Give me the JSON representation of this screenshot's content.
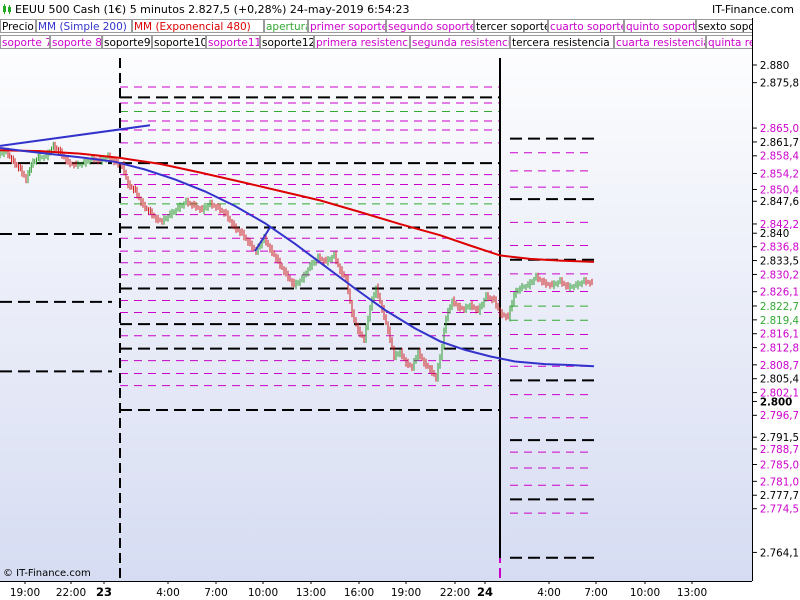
{
  "header": {
    "title": "EEUU 500 Cash (1€)   5 minutos   2.827,5 (+0,28%)   24-may-2019 6:54:23",
    "brand": "IT-Finance.com"
  },
  "legend_row1": [
    {
      "label": "Precio",
      "color": "#000000"
    },
    {
      "label": "MM (Simple 200)",
      "color": "#3333cc"
    },
    {
      "label": "MM (Exponencial 480)",
      "color": "#dd0000"
    },
    {
      "label": "apertura",
      "color": "#33aa33"
    },
    {
      "label": "primer soporte",
      "color": "#cc00cc"
    },
    {
      "label": "segundo soporte",
      "color": "#cc00cc"
    },
    {
      "label": "tercer soporte",
      "color": "#000000"
    },
    {
      "label": "cuarto soporte",
      "color": "#cc00cc"
    },
    {
      "label": "quinto soporte",
      "color": "#cc00cc"
    },
    {
      "label": "sexto soporte",
      "color": "#000000"
    }
  ],
  "legend_row2": [
    {
      "label": "soporte 7",
      "color": "#cc00cc"
    },
    {
      "label": "soporte 8",
      "color": "#cc00cc"
    },
    {
      "label": "soporte9",
      "color": "#000000"
    },
    {
      "label": "soporte10",
      "color": "#000000"
    },
    {
      "label": "soporte11",
      "color": "#cc00cc"
    },
    {
      "label": "soporte12",
      "color": "#000000"
    },
    {
      "label": "primera resistencia",
      "color": "#cc00cc"
    },
    {
      "label": "segunda resistencia",
      "color": "#cc00cc"
    },
    {
      "label": "tercera resistencia",
      "color": "#000000"
    },
    {
      "label": "cuarta resistencia",
      "color": "#cc00cc"
    },
    {
      "label": "quinta resi",
      "color": "#cc00cc"
    }
  ],
  "copyright": "© IT-Finance.com",
  "chart_data": {
    "type": "line",
    "ylim": [
      2.7625,
      2.882
    ],
    "y_ticks": [
      {
        "label": "2.880",
        "value": 2.88,
        "color": "#000000"
      },
      {
        "label": "2.875,8",
        "value": 2.8758,
        "color": "#000000"
      },
      {
        "label": "2.865,0",
        "value": 2.865,
        "color": "#cc00cc"
      },
      {
        "label": "2.861,7",
        "value": 2.8617,
        "color": "#000000"
      },
      {
        "label": "2.858,4",
        "value": 2.8584,
        "color": "#cc00cc"
      },
      {
        "label": "2.854,2",
        "value": 2.8542,
        "color": "#cc00cc"
      },
      {
        "label": "2.850,4",
        "value": 2.8504,
        "color": "#cc00cc"
      },
      {
        "label": "2.847,6",
        "value": 2.8476,
        "color": "#000000"
      },
      {
        "label": "2.842,2",
        "value": 2.8422,
        "color": "#cc00cc"
      },
      {
        "label": "2.840",
        "value": 2.84,
        "color": "#000000"
      },
      {
        "label": "2.836,8",
        "value": 2.8368,
        "color": "#cc00cc"
      },
      {
        "label": "2.833,5",
        "value": 2.8335,
        "color": "#000000"
      },
      {
        "label": "2.830,2",
        "value": 2.8302,
        "color": "#cc00cc"
      },
      {
        "label": "2.826,1",
        "value": 2.8261,
        "color": "#cc00cc"
      },
      {
        "label": "2.822,7",
        "value": 2.8227,
        "color": "#33aa33"
      },
      {
        "label": "2.819,4",
        "value": 2.8194,
        "color": "#33aa33"
      },
      {
        "label": "2.816,1",
        "value": 2.8161,
        "color": "#cc00cc"
      },
      {
        "label": "2.812,8",
        "value": 2.8128,
        "color": "#cc00cc"
      },
      {
        "label": "2.808,7",
        "value": 2.8087,
        "color": "#cc00cc"
      },
      {
        "label": "2.805,4",
        "value": 2.8054,
        "color": "#000000"
      },
      {
        "label": "2.802,1",
        "value": 2.8021,
        "color": "#cc00cc"
      },
      {
        "label": "2.800",
        "value": 2.8,
        "color": "#000000"
      },
      {
        "label": "2.796,7",
        "value": 2.7967,
        "color": "#cc00cc"
      },
      {
        "label": "2.791,5",
        "value": 2.7915,
        "color": "#000000"
      },
      {
        "label": "2.788,7",
        "value": 2.7887,
        "color": "#cc00cc"
      },
      {
        "label": "2.785,0",
        "value": 2.785,
        "color": "#cc00cc"
      },
      {
        "label": "2.781,0",
        "value": 2.781,
        "color": "#cc00cc"
      },
      {
        "label": "2.777,7",
        "value": 2.7777,
        "color": "#000000"
      },
      {
        "label": "2.774,5",
        "value": 2.7745,
        "color": "#cc00cc"
      },
      {
        "label": "2.764,1",
        "value": 2.7641,
        "color": "#000000"
      }
    ],
    "x_ticks": [
      "19:00",
      "22:00",
      "23",
      "4:00",
      "7:00",
      "10:00",
      "13:00",
      "16:00",
      "19:00",
      "22:00",
      "24",
      "4:00",
      "7:00",
      "10:00",
      "13:00"
    ],
    "day_bold_ticks": [
      "23",
      "24"
    ],
    "sma200": [
      [
        0,
        2.8595
      ],
      [
        25,
        2.8588
      ],
      [
        55,
        2.858
      ],
      [
        85,
        2.8572
      ],
      [
        115,
        2.8563
      ],
      [
        145,
        2.8545
      ],
      [
        175,
        2.8522
      ],
      [
        205,
        2.8494
      ],
      [
        235,
        2.846
      ],
      [
        265,
        2.842
      ],
      [
        295,
        2.8372
      ],
      [
        325,
        2.832
      ],
      [
        355,
        2.8268
      ],
      [
        385,
        2.8218
      ],
      [
        415,
        2.8175
      ],
      [
        440,
        2.8145
      ],
      [
        465,
        2.8125
      ],
      [
        490,
        2.811
      ],
      [
        515,
        2.8098
      ],
      [
        545,
        2.8092
      ],
      [
        570,
        2.809
      ],
      [
        594,
        2.8087
      ]
    ],
    "ema480": [
      [
        0,
        2.859
      ],
      [
        40,
        2.8588
      ],
      [
        80,
        2.8582
      ],
      [
        120,
        2.8572
      ],
      [
        160,
        2.8558
      ],
      [
        200,
        2.8538
      ],
      [
        240,
        2.8517
      ],
      [
        280,
        2.8495
      ],
      [
        320,
        2.8473
      ],
      [
        360,
        2.8446
      ],
      [
        400,
        2.8418
      ],
      [
        440,
        2.8392
      ],
      [
        470,
        2.8368
      ],
      [
        500,
        2.8345
      ],
      [
        530,
        2.8337
      ],
      [
        560,
        2.8333
      ],
      [
        594,
        2.833
      ]
    ],
    "price": [
      [
        0,
        2.858
      ],
      [
        8,
        2.8586
      ],
      [
        15,
        2.8562
      ],
      [
        22,
        2.8545
      ],
      [
        28,
        2.8522
      ],
      [
        33,
        2.8558
      ],
      [
        40,
        2.8572
      ],
      [
        48,
        2.8575
      ],
      [
        55,
        2.86
      ],
      [
        62,
        2.8585
      ],
      [
        70,
        2.856
      ],
      [
        78,
        2.8555
      ],
      [
        86,
        2.856
      ],
      [
        94,
        2.857
      ],
      [
        102,
        2.8565
      ],
      [
        110,
        2.8575
      ],
      [
        118,
        2.856
      ],
      [
        124,
        2.8555
      ],
      [
        130,
        2.851
      ],
      [
        137,
        2.8495
      ],
      [
        145,
        2.846
      ],
      [
        152,
        2.8445
      ],
      [
        158,
        2.843
      ],
      [
        164,
        2.8425
      ],
      [
        172,
        2.844
      ],
      [
        180,
        2.8455
      ],
      [
        188,
        2.847
      ],
      [
        196,
        2.846
      ],
      [
        204,
        2.845
      ],
      [
        212,
        2.8465
      ],
      [
        220,
        2.8455
      ],
      [
        228,
        2.844
      ],
      [
        236,
        2.841
      ],
      [
        244,
        2.8395
      ],
      [
        252,
        2.837
      ],
      [
        258,
        2.8355
      ],
      [
        266,
        2.8385
      ],
      [
        272,
        2.836
      ],
      [
        280,
        2.833
      ],
      [
        288,
        2.83
      ],
      [
        296,
        2.8275
      ],
      [
        304,
        2.829
      ],
      [
        312,
        2.832
      ],
      [
        320,
        2.834
      ],
      [
        328,
        2.833
      ],
      [
        336,
        2.8345
      ],
      [
        342,
        2.831
      ],
      [
        348,
        2.829
      ],
      [
        354,
        2.821
      ],
      [
        360,
        2.817
      ],
      [
        366,
        2.815
      ],
      [
        372,
        2.8225
      ],
      [
        378,
        2.827
      ],
      [
        384,
        2.822
      ],
      [
        390,
        2.817
      ],
      [
        396,
        2.811
      ],
      [
        402,
        2.812
      ],
      [
        408,
        2.8095
      ],
      [
        414,
        2.8085
      ],
      [
        420,
        2.812
      ],
      [
        426,
        2.8095
      ],
      [
        432,
        2.808
      ],
      [
        438,
        2.806
      ],
      [
        444,
        2.8135
      ],
      [
        448,
        2.82
      ],
      [
        454,
        2.824
      ],
      [
        460,
        2.8225
      ],
      [
        466,
        2.822
      ],
      [
        472,
        2.823
      ],
      [
        480,
        2.8215
      ],
      [
        488,
        2.825
      ],
      [
        496,
        2.824
      ],
      [
        502,
        2.821
      ],
      [
        510,
        2.82
      ],
      [
        516,
        2.8255
      ],
      [
        522,
        2.827
      ],
      [
        530,
        2.8275
      ],
      [
        538,
        2.8295
      ],
      [
        546,
        2.828
      ],
      [
        554,
        2.8275
      ],
      [
        562,
        2.8285
      ],
      [
        570,
        2.827
      ],
      [
        578,
        2.8275
      ],
      [
        586,
        2.8285
      ],
      [
        594,
        2.828
      ]
    ],
    "trend_lines": [
      {
        "color": "#3333cc",
        "from": [
          0,
          2.86
        ],
        "to": [
          150,
          2.8648
        ]
      },
      {
        "color": "#3333cc",
        "from": [
          255,
          2.8355
        ],
        "to": [
          270,
          2.841
        ]
      }
    ],
    "day_separators": [
      {
        "x": 120,
        "color": "#000000",
        "label": "23"
      },
      {
        "x": 500,
        "color": "#cc00cc",
        "label": "24"
      }
    ],
    "day1_levels": [
      {
        "value": 2.8737,
        "color": "#cc00cc",
        "style": "dash_thin"
      },
      {
        "value": 2.8713,
        "color": "#000000",
        "style": "dash_bold"
      },
      {
        "value": 2.87,
        "color": "#cc00cc",
        "style": "dash_thin"
      },
      {
        "value": 2.868,
        "color": "#33aa33",
        "style": "dash_thin"
      },
      {
        "value": 2.8658,
        "color": "#cc00cc",
        "style": "dash_thin"
      },
      {
        "value": 2.8637,
        "color": "#cc00cc",
        "style": "dash_thin"
      },
      {
        "value": 2.8607,
        "color": "#cc00cc",
        "style": "dash_thin"
      },
      {
        "value": 2.856,
        "color": "#000000",
        "style": "dash_bold"
      },
      {
        "value": 2.8533,
        "color": "#cc00cc",
        "style": "dash_thin"
      },
      {
        "value": 2.851,
        "color": "#cc00cc",
        "style": "dash_thin"
      },
      {
        "value": 2.848,
        "color": "#cc00cc",
        "style": "dash_thin"
      },
      {
        "value": 2.8465,
        "color": "#33aa33",
        "style": "dash_thin"
      },
      {
        "value": 2.844,
        "color": "#cc00cc",
        "style": "dash_thin"
      },
      {
        "value": 2.841,
        "color": "#000000",
        "style": "dash_bold"
      },
      {
        "value": 2.8385,
        "color": "#cc00cc",
        "style": "dash_thin"
      },
      {
        "value": 2.8355,
        "color": "#cc00cc",
        "style": "dash_thin"
      },
      {
        "value": 2.8328,
        "color": "#cc00cc",
        "style": "dash_thin"
      },
      {
        "value": 2.83,
        "color": "#cc00cc",
        "style": "dash_thin"
      },
      {
        "value": 2.8268,
        "color": "#000000",
        "style": "dash_bold"
      },
      {
        "value": 2.824,
        "color": "#cc00cc",
        "style": "dash_thin"
      },
      {
        "value": 2.8212,
        "color": "#cc00cc",
        "style": "dash_thin"
      },
      {
        "value": 2.8185,
        "color": "#000000",
        "style": "dash_bold"
      },
      {
        "value": 2.8158,
        "color": "#cc00cc",
        "style": "dash_thin"
      },
      {
        "value": 2.8128,
        "color": "#000000",
        "style": "dash_bold"
      },
      {
        "value": 2.81,
        "color": "#cc00cc",
        "style": "dash_thin"
      },
      {
        "value": 2.807,
        "color": "#cc00cc",
        "style": "dash_thin"
      },
      {
        "value": 2.8042,
        "color": "#cc00cc",
        "style": "dash_thin"
      },
      {
        "value": 2.7985,
        "color": "#000000",
        "style": "dash_bold"
      }
    ],
    "day2_levels": [
      {
        "value": 2.8617,
        "color": "#000000",
        "style": "dash_bold"
      },
      {
        "value": 2.8584,
        "color": "#cc00cc",
        "style": "dash_thin"
      },
      {
        "value": 2.8542,
        "color": "#cc00cc",
        "style": "dash_thin"
      },
      {
        "value": 2.8504,
        "color": "#cc00cc",
        "style": "dash_thin"
      },
      {
        "value": 2.8476,
        "color": "#000000",
        "style": "dash_bold"
      },
      {
        "value": 2.8422,
        "color": "#cc00cc",
        "style": "dash_thin"
      },
      {
        "value": 2.8368,
        "color": "#cc00cc",
        "style": "dash_thin"
      },
      {
        "value": 2.8335,
        "color": "#000000",
        "style": "dash_bold"
      },
      {
        "value": 2.8302,
        "color": "#cc00cc",
        "style": "dash_thin"
      },
      {
        "value": 2.8261,
        "color": "#cc00cc",
        "style": "dash_thin"
      },
      {
        "value": 2.8227,
        "color": "#33aa33",
        "style": "dash_thin"
      },
      {
        "value": 2.8194,
        "color": "#33aa33",
        "style": "dash_thin"
      },
      {
        "value": 2.8161,
        "color": "#cc00cc",
        "style": "dash_thin"
      },
      {
        "value": 2.8128,
        "color": "#cc00cc",
        "style": "dash_thin"
      },
      {
        "value": 2.8087,
        "color": "#cc00cc",
        "style": "dash_thin"
      },
      {
        "value": 2.8054,
        "color": "#000000",
        "style": "dash_bold"
      },
      {
        "value": 2.8021,
        "color": "#cc00cc",
        "style": "dash_thin"
      },
      {
        "value": 2.7967,
        "color": "#cc00cc",
        "style": "dash_thin"
      },
      {
        "value": 2.7915,
        "color": "#000000",
        "style": "dash_bold"
      },
      {
        "value": 2.7887,
        "color": "#cc00cc",
        "style": "dash_thin"
      },
      {
        "value": 2.785,
        "color": "#cc00cc",
        "style": "dash_thin"
      },
      {
        "value": 2.781,
        "color": "#cc00cc",
        "style": "dash_thin"
      },
      {
        "value": 2.7777,
        "color": "#000000",
        "style": "dash_bold"
      },
      {
        "value": 2.7745,
        "color": "#cc00cc",
        "style": "dash_thin"
      },
      {
        "value": 2.7641,
        "color": "#000000",
        "style": "dash_bold"
      }
    ],
    "prev_day_levels": [
      {
        "value": 2.856,
        "color": "#000000",
        "style": "dash_bold"
      },
      {
        "value": 2.8395,
        "color": "#000000",
        "style": "dash_bold"
      },
      {
        "value": 2.8237,
        "color": "#000000",
        "style": "dash_bold"
      },
      {
        "value": 2.8075,
        "color": "#000000",
        "style": "dash_bold"
      }
    ],
    "colors": {
      "price_up": "#2a9a2a",
      "price_down": "#cc2222",
      "sma": "#3333cc",
      "ema": "#dd0000",
      "bg_top": "#ffffff",
      "bg_bottom": "#d6dcf2"
    }
  }
}
